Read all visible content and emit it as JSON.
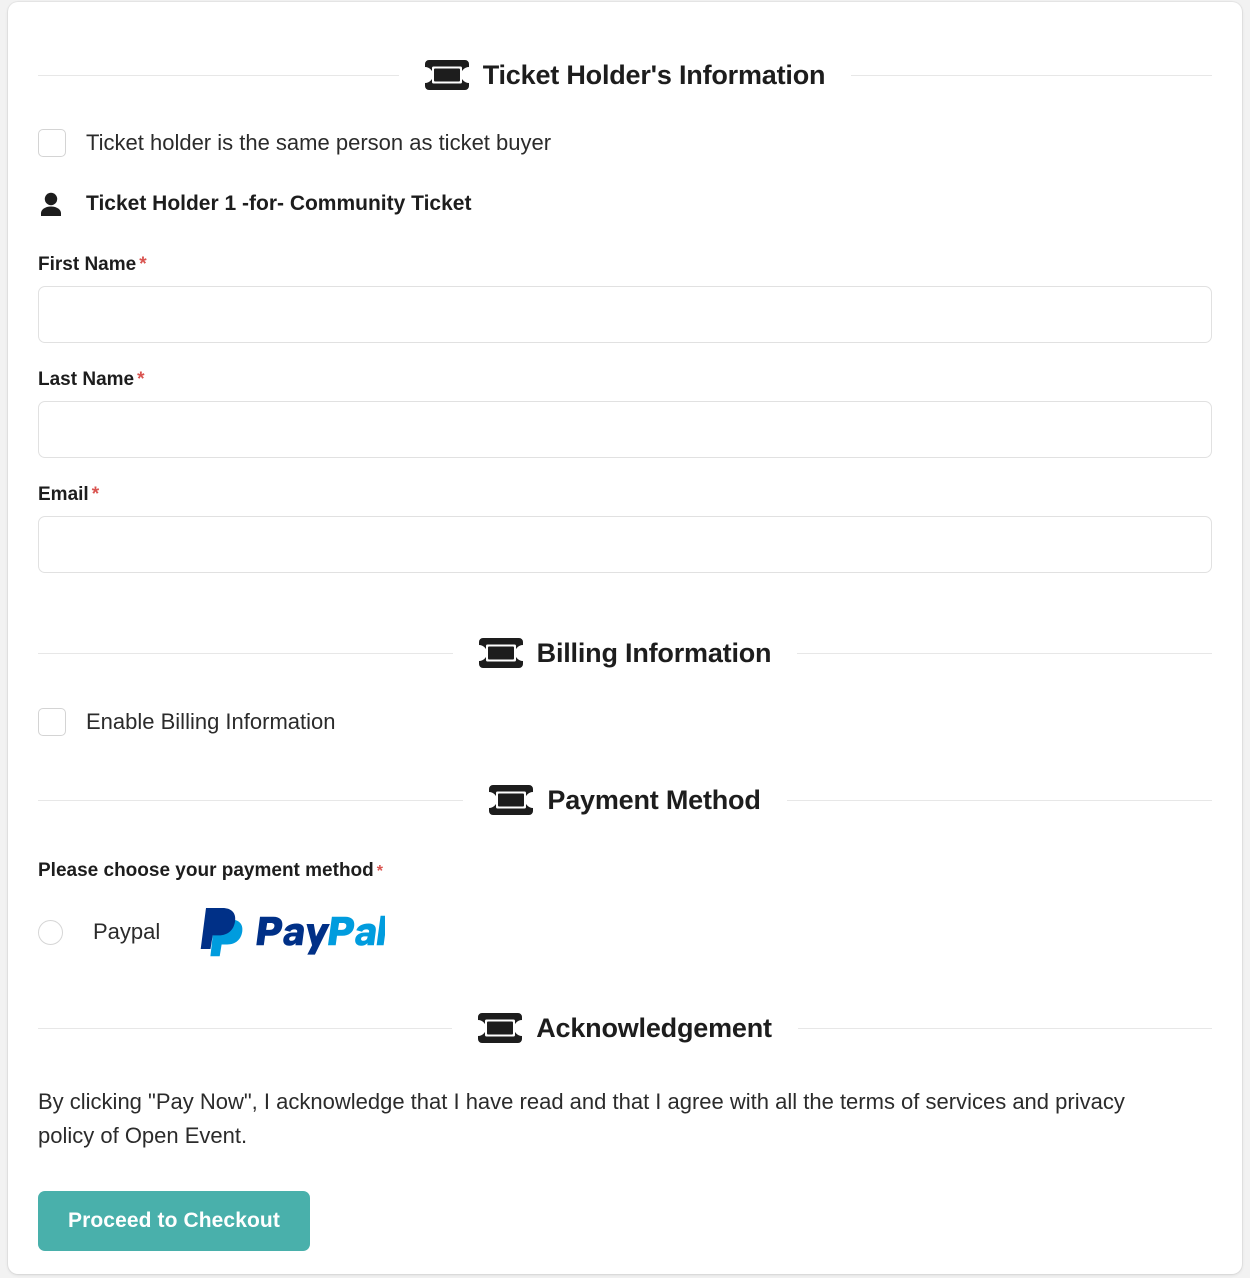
{
  "sections": {
    "ticket_holder": {
      "icon": "ticket-icon",
      "title": "Ticket Holder's Information",
      "same_person_checkbox": {
        "label": "Ticket holder is the same person as ticket buyer",
        "checked": false
      },
      "holder": {
        "icon": "person-icon",
        "title": "Ticket Holder 1 -for- Community Ticket"
      },
      "fields": [
        {
          "label": "First Name",
          "required_mark": "*",
          "value": "",
          "placeholder": ""
        },
        {
          "label": "Last Name",
          "required_mark": "*",
          "value": "",
          "placeholder": ""
        },
        {
          "label": "Email",
          "required_mark": "*",
          "value": "",
          "placeholder": ""
        }
      ]
    },
    "billing": {
      "icon": "ticket-icon",
      "title": "Billing Information",
      "enable_checkbox": {
        "label": "Enable Billing Information",
        "checked": false
      }
    },
    "payment": {
      "icon": "ticket-icon",
      "title": "Payment Method",
      "prompt": "Please choose your payment method",
      "required_mark": "*",
      "options": [
        {
          "label": "Paypal",
          "selected": false,
          "logo": "paypal-logo"
        }
      ]
    },
    "acknowledgement": {
      "icon": "ticket-icon",
      "title": "Acknowledgement",
      "text": "By clicking \"Pay Now\", I acknowledge that I have read and that I agree with all the terms of services and privacy policy of Open Event.",
      "checkout_button": "Proceed to Checkout"
    }
  },
  "colors": {
    "accent_teal": "#49b0ab",
    "required_red": "#d9534f",
    "paypal_dark": "#003087",
    "paypal_light": "#009cde",
    "text": "#2b2b2b",
    "border": "#e1e1e1",
    "rule": "#e7e7e7"
  }
}
